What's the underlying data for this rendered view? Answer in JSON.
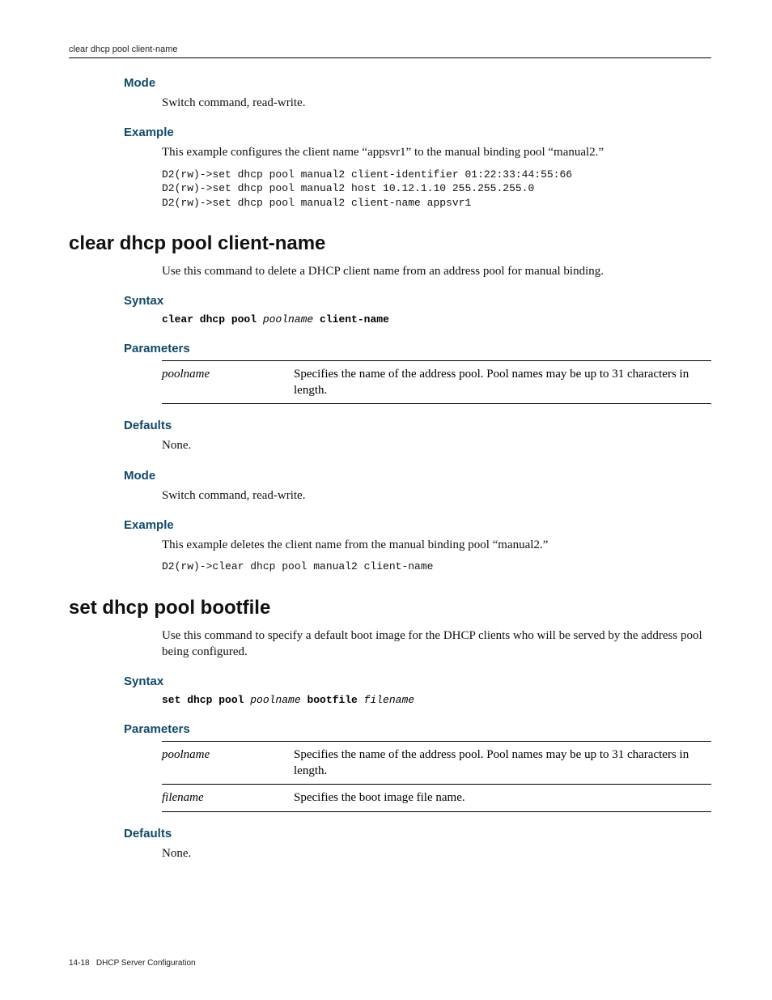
{
  "running_head": "clear dhcp pool client-name",
  "sec1": {
    "mode_h": "Mode",
    "mode_text": "Switch command, read-write.",
    "example_h": "Example",
    "example_text": "This example configures the client name “appsvr1” to the manual binding pool “manual2.”",
    "example_code": "D2(rw)->set dhcp pool manual2 client-identifier 01:22:33:44:55:66\nD2(rw)->set dhcp pool manual2 host 10.12.1.10 255.255.255.0\nD2(rw)->set dhcp pool manual2 client-name appsvr1"
  },
  "sec2": {
    "title": "clear dhcp pool client-name",
    "intro": "Use this command to delete a DHCP client name from an address pool for manual binding.",
    "syntax_h": "Syntax",
    "syntax_kw1": "clear dhcp pool ",
    "syntax_var1": "poolname",
    "syntax_kw2": " client-name",
    "params_h": "Parameters",
    "params": [
      {
        "name": "poolname",
        "desc": "Specifies the name of the address pool. Pool names may be up to 31 characters in length."
      }
    ],
    "defaults_h": "Defaults",
    "defaults_text": "None.",
    "mode_h": "Mode",
    "mode_text": "Switch command, read-write.",
    "example_h": "Example",
    "example_text": "This example deletes the client name from the manual binding pool “manual2.”",
    "example_code": "D2(rw)->clear dhcp pool manual2 client-name"
  },
  "sec3": {
    "title": "set dhcp pool bootfile",
    "intro": "Use this command to specify a default boot image for the DHCP clients who will be served by the address pool being configured.",
    "syntax_h": "Syntax",
    "syntax_kw1": "set dhcp pool ",
    "syntax_var1": "poolname",
    "syntax_kw2": " bootfile ",
    "syntax_var2": "filename",
    "params_h": "Parameters",
    "params": [
      {
        "name": "poolname",
        "desc": "Specifies the name of the address pool. Pool names may be up to 31 characters in length."
      },
      {
        "name": "filename",
        "desc": "Specifies the boot image file name."
      }
    ],
    "defaults_h": "Defaults",
    "defaults_text": "None."
  },
  "footer": {
    "page": "14-18",
    "chapter": "DHCP Server Configuration"
  }
}
